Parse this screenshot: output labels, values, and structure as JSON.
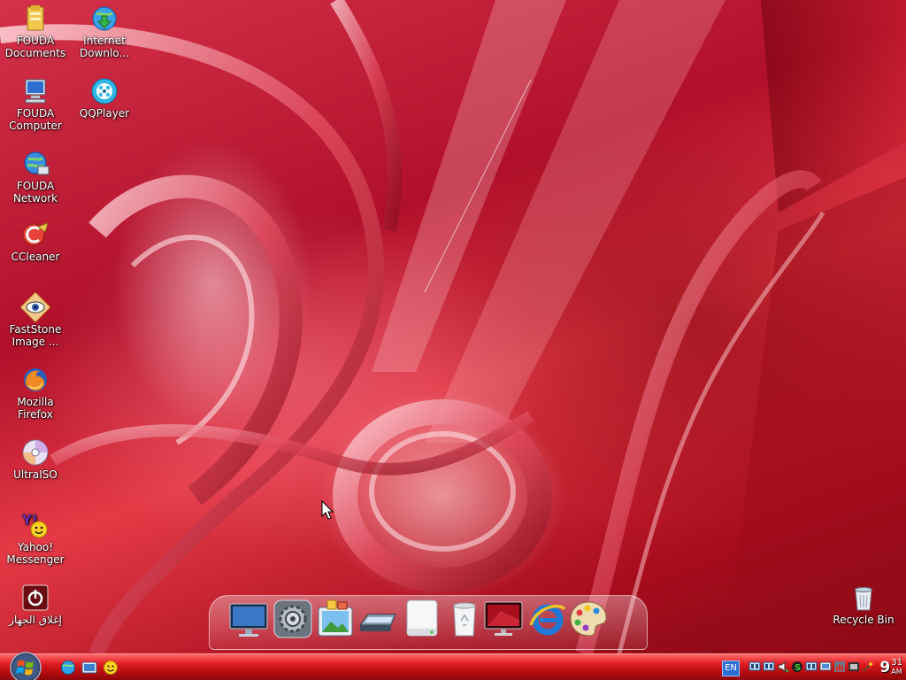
{
  "desktop": {
    "icons_left": [
      {
        "label": "FOUDA Documents",
        "icon": "folder-icon"
      },
      {
        "label": "FOUDA Computer",
        "icon": "computer-icon"
      },
      {
        "label": "FOUDA Network",
        "icon": "network-icon"
      },
      {
        "label": "CCleaner",
        "icon": "ccleaner-icon"
      },
      {
        "label": "FastStone Image ...",
        "icon": "faststone-eye-icon"
      },
      {
        "label": "Mozilla Firefox",
        "icon": "firefox-icon"
      },
      {
        "label": "UltraISO",
        "icon": "disc-icon"
      },
      {
        "label": "Yahoo! Messenger",
        "icon": "yahoo-messenger-icon"
      },
      {
        "label": "إغلاق الجهاز",
        "icon": "power-icon"
      }
    ],
    "icons_second": [
      {
        "label": "Internet Downlo...",
        "icon": "internet-download-manager-icon"
      },
      {
        "label": "QQPlayer",
        "icon": "qqplayer-icon"
      }
    ],
    "recycle_bin": {
      "label": "Recycle Bin",
      "icon": "recycle-bin-icon"
    }
  },
  "dock": {
    "items": [
      {
        "icon": "monitor-icon"
      },
      {
        "icon": "system-gear-icon"
      },
      {
        "icon": "photo-gallery-icon"
      },
      {
        "icon": "scanner-icon"
      },
      {
        "icon": "hard-drive-icon"
      },
      {
        "icon": "recycle-can-icon"
      },
      {
        "icon": "display-icon"
      },
      {
        "icon": "internet-explorer-icon"
      },
      {
        "icon": "paint-palette-icon"
      }
    ]
  },
  "taskbar": {
    "start_icon": "windows-orb-icon",
    "quick_launch": [
      {
        "icon": "browser-icon"
      },
      {
        "icon": "show-desktop-icon"
      },
      {
        "icon": "messenger-smiley-icon"
      }
    ],
    "language": "EN",
    "tray_icons": [
      {
        "icon": "network-tray-icon"
      },
      {
        "icon": "network-tray-icon-2"
      },
      {
        "icon": "speaker-icon"
      },
      {
        "icon": "skype-icon"
      },
      {
        "icon": "network-tray-icon-3"
      },
      {
        "icon": "monitor-tray-icon"
      },
      {
        "icon": "chart-tray-icon"
      },
      {
        "icon": "film-tray-icon"
      },
      {
        "icon": "wand-tray-icon"
      }
    ],
    "clock": {
      "hour": "9",
      "minutes": "31",
      "ampm": "AM"
    }
  },
  "colors": {
    "taskbar": "#d3161b",
    "wallpaper_primary": "#c21a30",
    "tray_language": "#2b6fd6"
  }
}
